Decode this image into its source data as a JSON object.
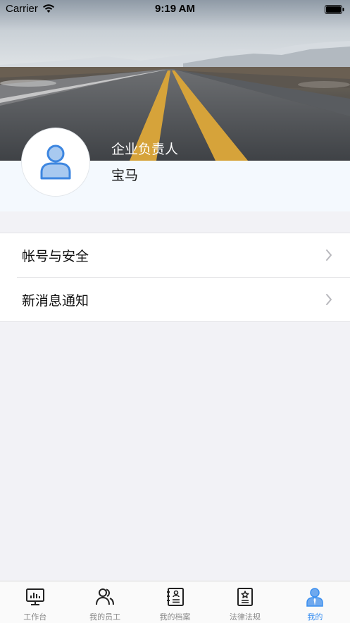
{
  "status_bar": {
    "carrier": "Carrier",
    "time": "9:19 AM"
  },
  "profile": {
    "role": "企业负责人",
    "company": "宝马"
  },
  "menu": {
    "items": [
      {
        "label": "帐号与安全"
      },
      {
        "label": "新消息通知"
      }
    ]
  },
  "tabbar": {
    "active_color": "#3a8ff0",
    "items": [
      {
        "label": "工作台",
        "icon": "dashboard-icon"
      },
      {
        "label": "我的员工",
        "icon": "employees-icon"
      },
      {
        "label": "我的档案",
        "icon": "records-icon"
      },
      {
        "label": "法律法规",
        "icon": "laws-icon"
      },
      {
        "label": "我的",
        "icon": "profile-icon",
        "active": true
      }
    ]
  }
}
